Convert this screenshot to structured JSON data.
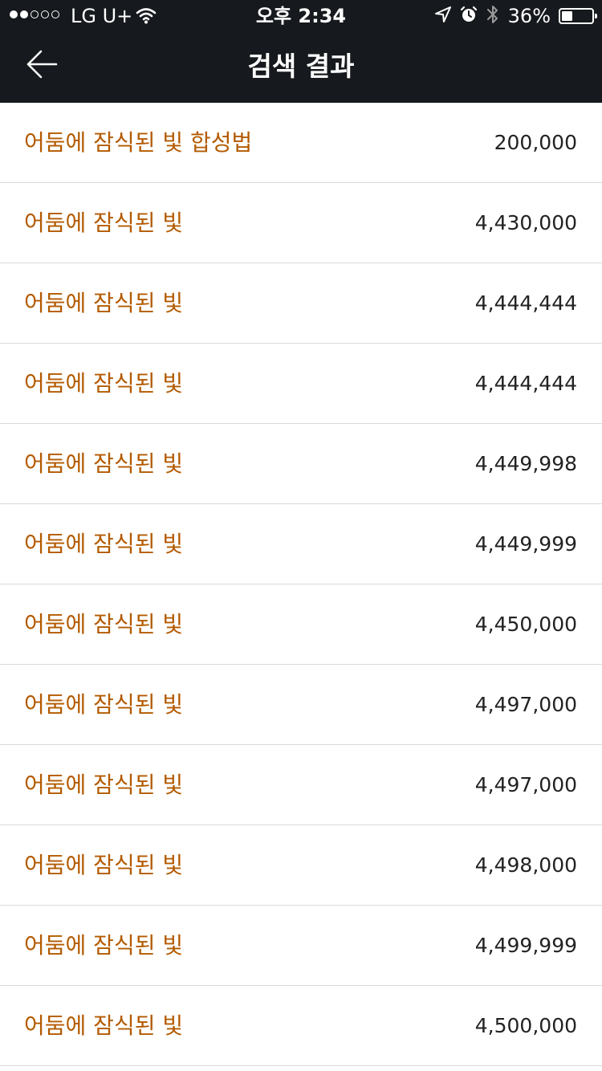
{
  "status_bar": {
    "carrier": "LG U+",
    "time": "오후 2:34",
    "battery_percent": "36%",
    "battery_level": 0.36,
    "signal_strength_bars": 2,
    "signal_total_bars": 5,
    "icons": [
      "wifi-icon",
      "location-arrow-icon",
      "alarm-clock-icon",
      "bluetooth-icon",
      "battery-icon"
    ]
  },
  "nav_bar": {
    "title": "검색 결과",
    "back_icon": "arrow-left-icon"
  },
  "results": [
    {
      "title": "어둠에 잠식된 빛 합성법",
      "price": "200,000"
    },
    {
      "title": "어둠에 잠식된 빛",
      "price": "4,430,000"
    },
    {
      "title": "어둠에 잠식된 빛",
      "price": "4,444,444"
    },
    {
      "title": "어둠에 잠식된 빛",
      "price": "4,444,444"
    },
    {
      "title": "어둠에 잠식된 빛",
      "price": "4,449,998"
    },
    {
      "title": "어둠에 잠식된 빛",
      "price": "4,449,999"
    },
    {
      "title": "어둠에 잠식된 빛",
      "price": "4,450,000"
    },
    {
      "title": "어둠에 잠식된 빛",
      "price": "4,497,000"
    },
    {
      "title": "어둠에 잠식된 빛",
      "price": "4,497,000"
    },
    {
      "title": "어둠에 잠식된 빛",
      "price": "4,498,000"
    },
    {
      "title": "어둠에 잠식된 빛",
      "price": "4,499,999"
    },
    {
      "title": "어둠에 잠식된 빛",
      "price": "4,500,000"
    }
  ],
  "colors": {
    "bar_background": "#16191d",
    "item_title": "#b35a00",
    "item_price": "#222222",
    "divider": "#d9d9d9"
  }
}
